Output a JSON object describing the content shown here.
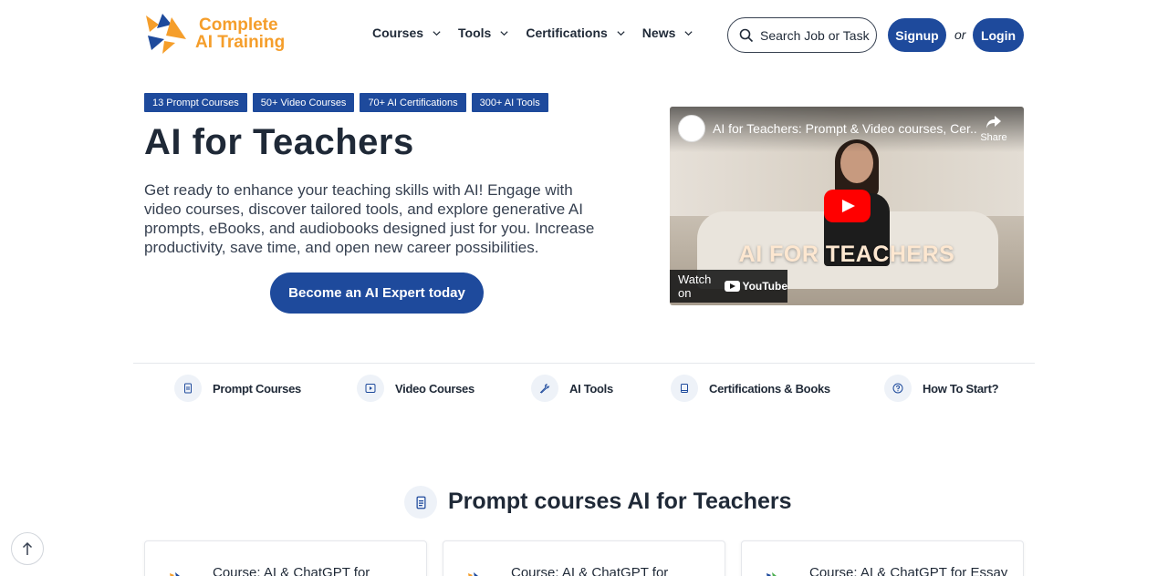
{
  "brand": {
    "line1": "Complete",
    "line2": "AI Training",
    "accent": "#f59e2b",
    "primary": "#1e4a9c"
  },
  "nav": [
    {
      "label": "Courses",
      "icon": "chevron-down-icon"
    },
    {
      "label": "Tools",
      "icon": "chevron-down-icon"
    },
    {
      "label": "Certifications",
      "icon": "chevron-down-icon"
    },
    {
      "label": "News",
      "icon": "chevron-down-icon"
    }
  ],
  "search": {
    "placeholder": "Search Job or Tasks",
    "icon": "search-icon"
  },
  "auth": {
    "signup": "Signup",
    "or": "or",
    "login": "Login"
  },
  "hero": {
    "badges": [
      "13 Prompt Courses",
      "50+ Video Courses",
      "70+ AI Certifications",
      "300+ AI Tools"
    ],
    "title": "AI for Teachers",
    "description": "Get ready to enhance your teaching skills with AI! Engage with video courses, discover tailored tools, and explore generative AI prompts, eBooks, and audiobooks designed just for you. Increase productivity, save time, and open new career possibilities.",
    "cta": "Become an AI Expert today"
  },
  "video": {
    "title": "AI for Teachers: Prompt & Video courses, Cer...",
    "share": "Share",
    "caption": "AI FOR TEACHERS",
    "watch_on": "Watch on",
    "youtube": "YouTube"
  },
  "tabs": [
    {
      "label": "Prompt Courses",
      "icon": "document-icon"
    },
    {
      "label": "Video Courses",
      "icon": "play-icon"
    },
    {
      "label": "AI Tools",
      "icon": "wrench-icon"
    },
    {
      "label": "Certifications & Books",
      "icon": "book-icon"
    },
    {
      "label": "How To Start?",
      "icon": "help-icon"
    }
  ],
  "section": {
    "title": "Prompt courses AI for Teachers",
    "icon": "document-icon"
  },
  "cards": [
    {
      "title": "Course: AI & ChatGPT for"
    },
    {
      "title": "Course: AI & ChatGPT for"
    },
    {
      "title": "Course: AI & ChatGPT for Essay"
    }
  ]
}
